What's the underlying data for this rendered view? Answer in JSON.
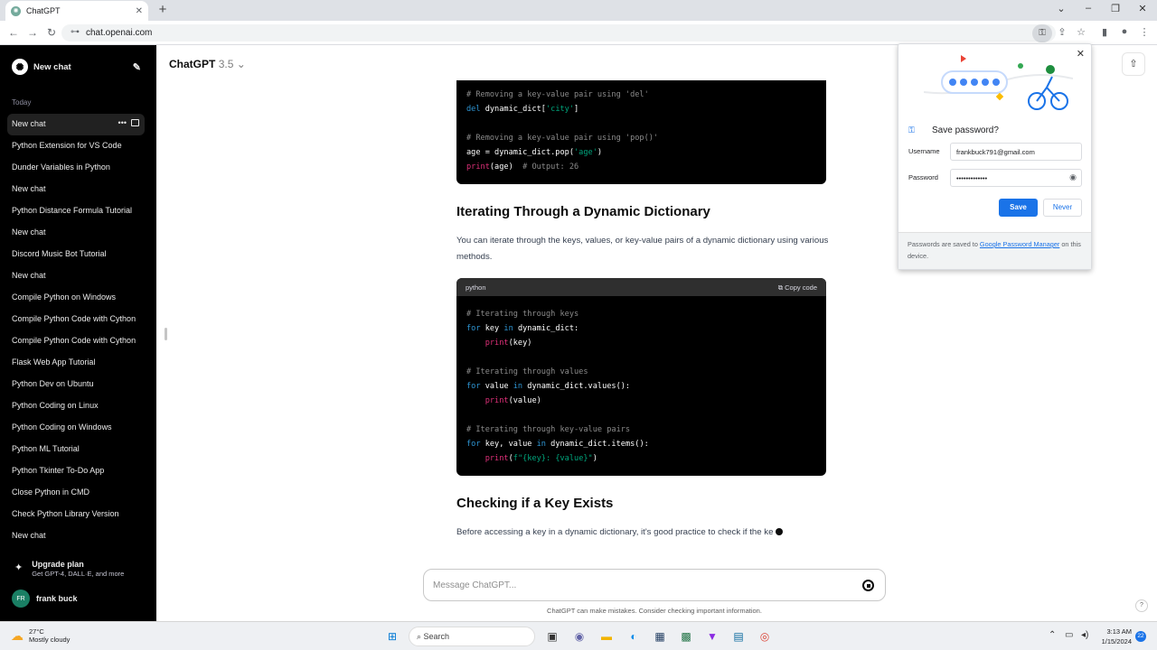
{
  "browser": {
    "tab_title": "ChatGPT",
    "url": "chat.openai.com"
  },
  "sidebar": {
    "new_chat": "New chat",
    "section_label": "Today",
    "items": [
      "New chat",
      "Python Extension for VS Code",
      "Dunder Variables in Python",
      "New chat",
      "Python Distance Formula Tutorial",
      "New chat",
      "Discord Music Bot Tutorial",
      "New chat",
      "Compile Python on Windows",
      "Compile Python Code with Cython",
      "Compile Python Code with Cython",
      "Flask Web App Tutorial",
      "Python Dev on Ubuntu",
      "Python Coding on Linux",
      "Python Coding on Windows",
      "Python ML Tutorial",
      "Python Tkinter To-Do App",
      "Close Python in CMD",
      "Check Python Library Version",
      "New chat"
    ],
    "upgrade_title": "Upgrade plan",
    "upgrade_sub": "Get GPT-4, DALL·E, and more",
    "user_initials": "FR",
    "user_name": "frank buck"
  },
  "main": {
    "model_name": "ChatGPT",
    "model_version": "3.5",
    "heading1": "Iterating Through a Dynamic Dictionary",
    "para1": "You can iterate through the keys, values, or key-value pairs of a dynamic dictionary using various methods.",
    "code_lang": "python",
    "copy_label": "Copy code",
    "heading2": "Checking if a Key Exists",
    "para2": "Before accessing a key in a dynamic dictionary, it's good practice to check if the ke",
    "composer_placeholder": "Message ChatGPT...",
    "disclaimer": "ChatGPT can make mistakes. Consider checking important information."
  },
  "password_popup": {
    "title": "Save password?",
    "username_label": "Username",
    "username_value": "frankbuck791@gmail.com",
    "password_label": "Password",
    "password_value": "•••••••••••••",
    "save_label": "Save",
    "never_label": "Never",
    "footer_prefix": "Passwords are saved to ",
    "footer_link": "Google Password Manager",
    "footer_suffix": " on this device."
  },
  "taskbar": {
    "temperature": "27°C",
    "weather": "Mostly cloudy",
    "search": "Search",
    "time": "3:13 AM",
    "date": "1/15/2024",
    "notifications": "22"
  },
  "colors": {
    "sidebar_bg": "#000000",
    "code_bg": "#000000",
    "accent": "#1a73e8"
  }
}
